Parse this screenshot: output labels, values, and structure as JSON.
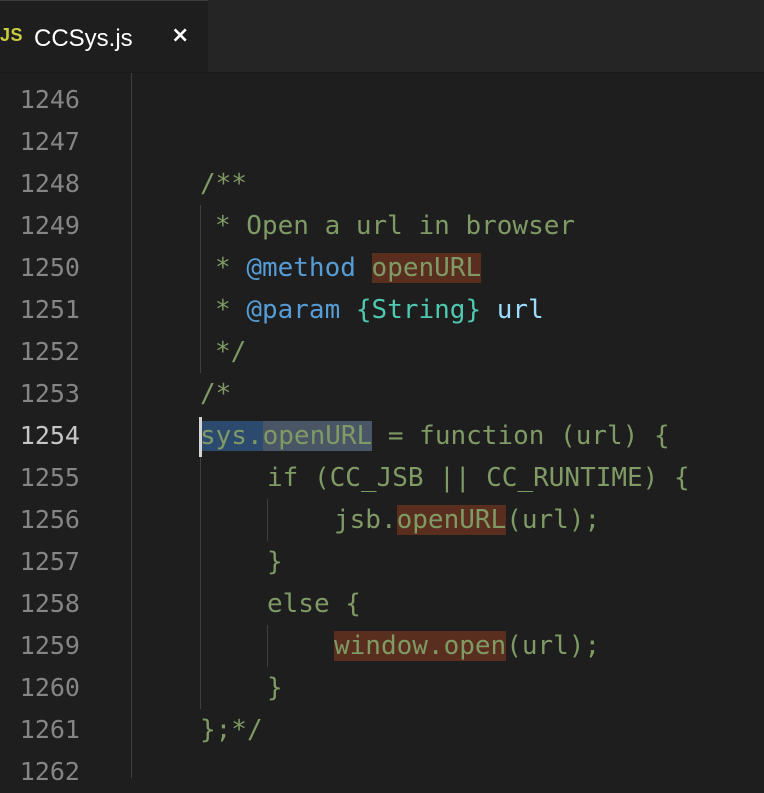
{
  "tab": {
    "lang_label": "JS",
    "title": "CCSys.js",
    "close_icon": "×"
  },
  "gutter": {
    "line_numbers": [
      "1246",
      "1247",
      "1248",
      "1249",
      "1250",
      "1251",
      "1252",
      "1253",
      "1254",
      "1255",
      "1256",
      "1257",
      "1258",
      "1259",
      "1260",
      "1261",
      "1262"
    ],
    "active_line": "1254"
  },
  "code": {
    "l1248": "/**",
    "l1249": "* Open a url in browser",
    "l1250_star": "* ",
    "l1250_tag": "@method",
    "l1250_name": "openURL",
    "l1251_star": "* ",
    "l1251_tag": "@param",
    "l1251_type": "{String}",
    "l1251_name": "url",
    "l1252": "*/",
    "l1253": "/*",
    "l1254_a": "sys.",
    "l1254_b": "openURL",
    "l1254_c": " = function (url) {",
    "l1255": "if (CC_JSB || CC_RUNTIME) {",
    "l1256_a": "jsb.",
    "l1256_b": "openURL",
    "l1256_c": "(url);",
    "l1257": "}",
    "l1258": "else {",
    "l1259_a": "window.open",
    "l1259_b": "(url);",
    "l1260": "}",
    "l1261": "};*/"
  },
  "colors": {
    "comment": "#7f9a65",
    "doc_tag": "#569cd6",
    "doc_type": "#4ec9b0",
    "highlight": "#5a2e1f",
    "selection": "#2c4a6e"
  }
}
